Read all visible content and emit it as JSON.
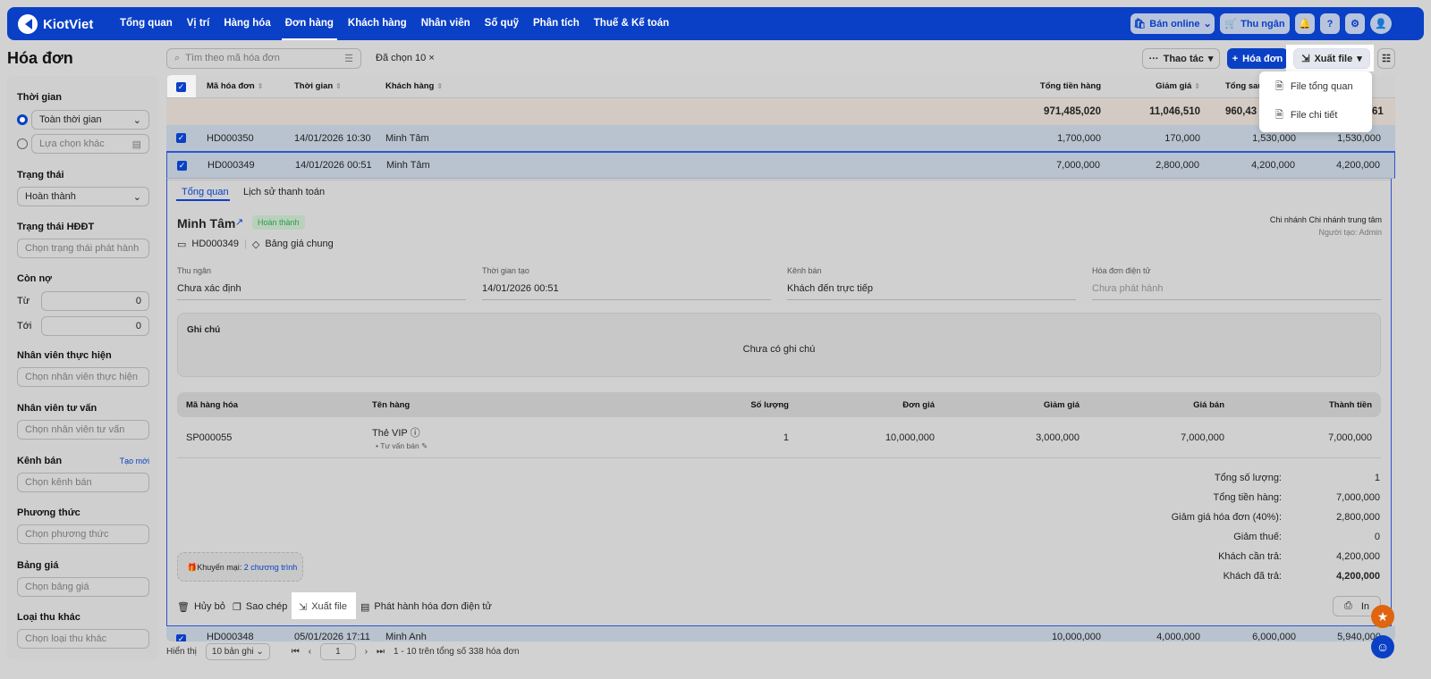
{
  "brand": "KiotViet",
  "nav": [
    "Tổng quan",
    "Vị trí",
    "Hàng hóa",
    "Đơn hàng",
    "Khách hàng",
    "Nhân viên",
    "Số quỹ",
    "Phân tích",
    "Thuế & Kế toán"
  ],
  "nav_active": "Đơn hàng",
  "top_right": {
    "online": "Bán online",
    "cashier": "Thu ngân"
  },
  "page_title": "Hóa đơn",
  "filters": {
    "time_label": "Thời gian",
    "time_all": "Toàn thời gian",
    "time_other": "Lựa chọn khác",
    "status_label": "Trạng thái",
    "status_value": "Hoàn thành",
    "einv_label": "Trạng thái HĐĐT",
    "einv_ph": "Chọn trạng thái phát hành",
    "debt_label": "Còn nợ",
    "from": "Từ",
    "to": "Tới",
    "from_val": "0",
    "to_val": "0",
    "staff_label": "Nhân viên thực hiện",
    "staff_ph": "Chọn nhân viên thực hiện",
    "advisor_label": "Nhân viên tư vấn",
    "advisor_ph": "Chọn nhân viên tư vấn",
    "channel_label": "Kênh bán",
    "channel_new": "Tạo mới",
    "channel_ph": "Chọn kênh bán",
    "method_label": "Phương thức",
    "method_ph": "Chọn phương thức",
    "price_label": "Bảng giá",
    "price_ph": "Chọn bảng giá",
    "income_label": "Loại thu khác",
    "income_ph": "Chọn loại thu khác"
  },
  "toolbar": {
    "search_ph": "Tìm theo mã hóa đơn",
    "selected": "Đã chọn 10 ×",
    "actions": "Thao tác",
    "new_invoice": "Hóa đơn",
    "export": "Xuất file"
  },
  "export_menu": [
    "File tổng quan",
    "File chi tiết"
  ],
  "table": {
    "headers": [
      "Mã hóa đơn",
      "Thời gian",
      "Khách hàng",
      "Tổng tiền hàng",
      "Giảm giá",
      "Tổng sau g",
      "61"
    ],
    "totals": [
      "971,485,020",
      "11,046,510",
      "960,43"
    ],
    "rows": [
      [
        "HD000350",
        "14/01/2026 10:30",
        "Minh Tâm",
        "1,700,000",
        "170,000",
        "1,530,000",
        "1,530,000"
      ],
      [
        "HD000349",
        "14/01/2026 00:51",
        "Minh Tâm",
        "7,000,000",
        "2,800,000",
        "4,200,000",
        "4,200,000"
      ],
      [
        "HD000348",
        "05/01/2026 17:11",
        "Minh Anh",
        "10,000,000",
        "4,000,000",
        "6,000,000",
        "5,940,000"
      ]
    ]
  },
  "detail": {
    "tabs": [
      "Tổng quan",
      "Lịch sử thanh toán"
    ],
    "customer": "Minh Tâm",
    "status": "Hoàn thành",
    "code": "HD000349",
    "pricebook": "Bảng giá chung",
    "branch": "Chi nhánh Chi nhánh trung tâm",
    "creator": "Người tạo: Admin",
    "fields": [
      {
        "label": "Thu ngân",
        "value": "Chưa xác định"
      },
      {
        "label": "Thời gian tạo",
        "value": "14/01/2026 00:51"
      },
      {
        "label": "Kênh bán",
        "value": "Khách đến trực tiếp"
      },
      {
        "label": "Hóa đơn điện tử",
        "value": "Chưa phát hành"
      }
    ],
    "note_label": "Ghi chú",
    "note_value": "Chưa có ghi chú",
    "item_headers": [
      "Mã hàng hóa",
      "Tên hàng",
      "Số lượng",
      "Đơn giá",
      "Giảm giá",
      "Giá bán",
      "Thành tiền"
    ],
    "item": {
      "code": "SP000055",
      "name": "Thẻ VIP",
      "sub": "Tư vấn bán",
      "qty": "1",
      "price": "10,000,000",
      "discount": "3,000,000",
      "sale": "7,000,000",
      "total": "7,000,000"
    },
    "summary": [
      [
        "Tổng số lượng:",
        "1"
      ],
      [
        "Tổng tiền hàng:",
        "7,000,000"
      ],
      [
        "Giảm giá hóa đơn (40%):",
        "2,800,000"
      ],
      [
        "Giảm thuế:",
        "0"
      ],
      [
        "Khách cần trả:",
        "4,200,000"
      ],
      [
        "Khách đã trả:",
        "4,200,000"
      ]
    ],
    "promo_label": "Khuyến mại:",
    "promo_link": "2 chương trình",
    "actions": [
      "Hủy bỏ",
      "Sao chép",
      "Xuất file",
      "Phát hành hóa đơn điện tử"
    ],
    "print": "In"
  },
  "footer": {
    "show": "Hiển thị",
    "per_page": "10 bản ghi",
    "page": "1",
    "info": "1 - 10 trên tổng số 338 hóa đơn"
  },
  "colors": {
    "brand": "#0a40c6",
    "success": "#2e9a4a",
    "fab_orange": "#e0650e"
  }
}
